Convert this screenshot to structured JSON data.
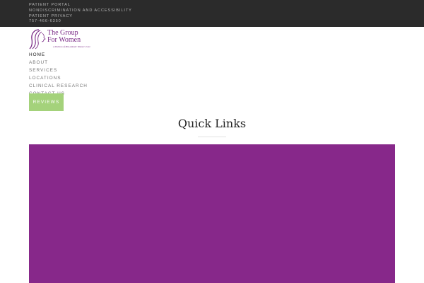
{
  "topbar": {
    "links": [
      "PATIENT PORTAL",
      "NONDISCRIMINATION AND ACCESSIBILITY",
      "PATIENT PRIVACY",
      "757-466-6350"
    ]
  },
  "logo": {
    "line1": "The Group",
    "line2": "For Women",
    "tagline": "A Division of Mid-Atlantic Women's Care",
    "icon": "woman-profile-icon",
    "color": "#7a2a86"
  },
  "nav": {
    "items": [
      "HOME",
      "ABOUT",
      "SERVICES",
      "LOCATIONS",
      "CLINICAL RESEARCH",
      "CONTACT US"
    ],
    "active": "HOME",
    "cta": "REVIEWS",
    "cta_color": "#a4d27b"
  },
  "quick_links": {
    "title": "Quick Links",
    "banner_color": "#87288a"
  }
}
